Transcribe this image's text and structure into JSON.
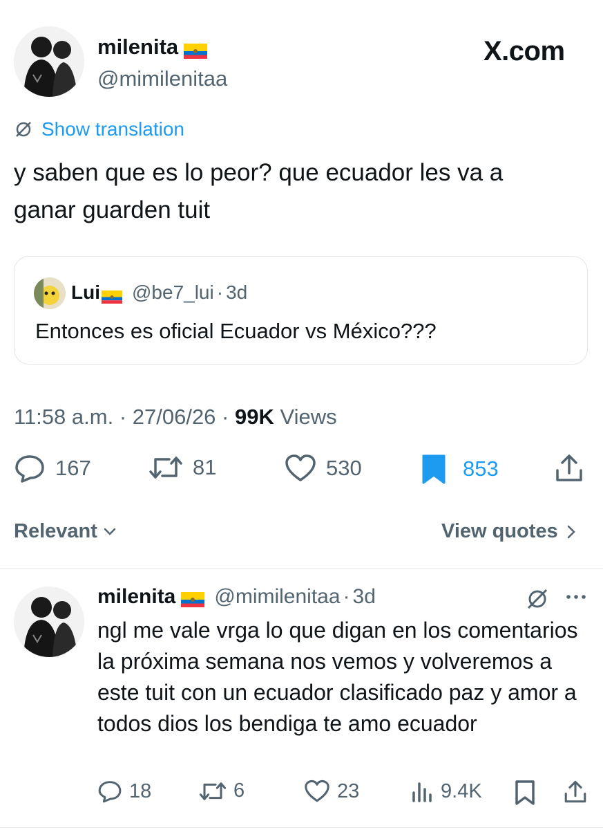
{
  "tweet": {
    "author_name": "milenita",
    "author_handle": "@mimilenitaa",
    "brand": "X.com",
    "show_translation": "Show translation",
    "text": "y saben que es lo peor? que ecuador les va a ganar guarden tuit",
    "quote": {
      "author_name": "Lui",
      "author_handle": "@be7_lui",
      "separator": "·",
      "time": "3d",
      "text": "Entonces es oficial Ecuador vs México???"
    },
    "time": "11:58 a.m.",
    "date": "27/06/26",
    "views_count": "99K",
    "views_label": "Views",
    "stats": {
      "replies": "167",
      "reposts": "81",
      "likes": "530",
      "bookmarks": "853"
    }
  },
  "filters": {
    "sort_label": "Relevant",
    "view_quotes_label": "View quotes"
  },
  "reply": {
    "author_name": "milenita",
    "author_handle": "@mimilenitaa",
    "separator": "·",
    "time": "3d",
    "text": "ngl me vale vrga lo que digan en los comentarios la próxima semana nos vemos y volveremos a este tuit con un ecuador clasificado paz y amor a todos dios los bendiga te amo ecuador",
    "stats": {
      "replies": "18",
      "reposts": "6",
      "likes": "23",
      "views": "9.4K"
    }
  },
  "colors": {
    "accent": "#1d9bf0",
    "text": "#0f1419",
    "muted": "#536471"
  }
}
